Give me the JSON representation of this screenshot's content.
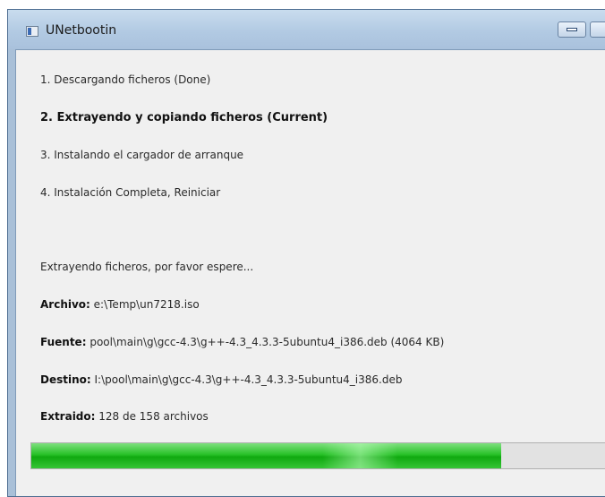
{
  "window": {
    "title": "UNetbootin"
  },
  "steps": [
    "1. Descargando ficheros (Done)",
    "2. Extrayendo y copiando ficheros (Current)",
    "3. Instalando el cargador de arranque",
    "4. Instalación Completa, Reiniciar"
  ],
  "status": {
    "message": "Extrayendo ficheros, por favor espere...",
    "archivo_label": "Archivo:",
    "archivo_value": "e:\\Temp\\un7218.iso",
    "fuente_label": "Fuente:",
    "fuente_value": "pool\\main\\g\\gcc-4.3\\g++-4.3_4.3.3-5ubuntu4_i386.deb (4064 KB)",
    "destino_label": "Destino:",
    "destino_value": "I:\\pool\\main\\g\\gcc-4.3\\g++-4.3_4.3.3-5ubuntu4_i386.deb",
    "extraido_label": "Extraido:",
    "extraido_value": "128 de 158 archivos"
  },
  "progress": {
    "fraction": 0.81
  },
  "colors": {
    "progress_green": "#1fb81f",
    "titlebar": "#b2cae3"
  }
}
